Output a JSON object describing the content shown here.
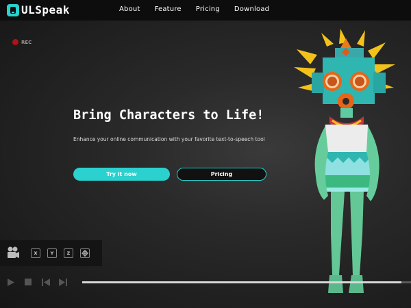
{
  "brand": {
    "name": "ULSpeak",
    "accent": "#2ad1cf"
  },
  "nav": {
    "items": [
      "About",
      "Feature",
      "Pricing",
      "Download"
    ]
  },
  "rec": {
    "label": "REC",
    "color": "#b31212"
  },
  "hero": {
    "title": "Bring Characters to Life!",
    "subtitle": "Enhance your online communication with your favorite text-to-speech tool",
    "primary_button": "Try it now",
    "secondary_button": "Pricing"
  },
  "camera_panel": {
    "icon": "video-camera-icon",
    "axes": [
      "X",
      "Y",
      "Z"
    ],
    "center_icon": "target-icon"
  },
  "player": {
    "icons": [
      "play-icon",
      "stop-icon",
      "skip-back-icon",
      "skip-forward-icon"
    ],
    "progress": 0.97
  }
}
